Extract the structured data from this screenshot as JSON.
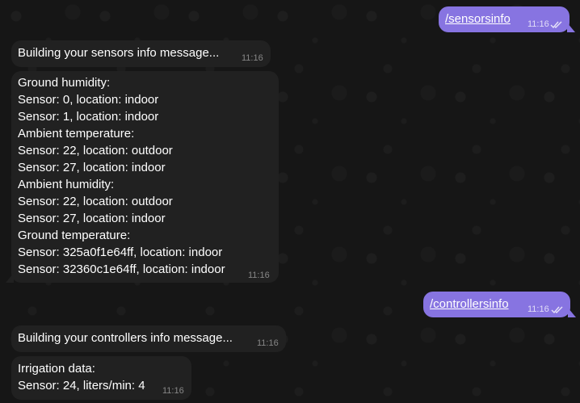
{
  "messages": [
    {
      "direction": "outgoing",
      "text": "/sensorsinfo",
      "time": "11:16",
      "status_icon": "double-check-icon"
    },
    {
      "direction": "incoming",
      "lines": [
        "Building your sensors info message..."
      ],
      "time": "11:16"
    },
    {
      "direction": "incoming",
      "lines": [
        "Ground humidity:",
        "Sensor: 0, location: indoor",
        "Sensor: 1, location: indoor",
        "Ambient temperature:",
        "Sensor: 22, location: outdoor",
        "Sensor: 27, location: indoor",
        "Ambient humidity:",
        "Sensor: 22, location: outdoor",
        "Sensor: 27, location: indoor",
        "Ground temperature:",
        "Sensor: 325a0f1e64ff, location: indoor",
        "Sensor: 32360c1e64ff, location: indoor"
      ],
      "time": "11:16"
    },
    {
      "direction": "outgoing",
      "text": "/controllersinfo",
      "time": "11:16",
      "status_icon": "double-check-icon"
    },
    {
      "direction": "incoming",
      "lines": [
        "Building your controllers info message..."
      ],
      "time": "11:16"
    },
    {
      "direction": "incoming",
      "lines": [
        "Irrigation data:",
        "Sensor: 24, liters/min: 4"
      ],
      "time": "11:16"
    }
  ],
  "colors": {
    "background": "#161616",
    "incoming_bubble": "#212121",
    "outgoing_bubble": "#8774e1"
  }
}
